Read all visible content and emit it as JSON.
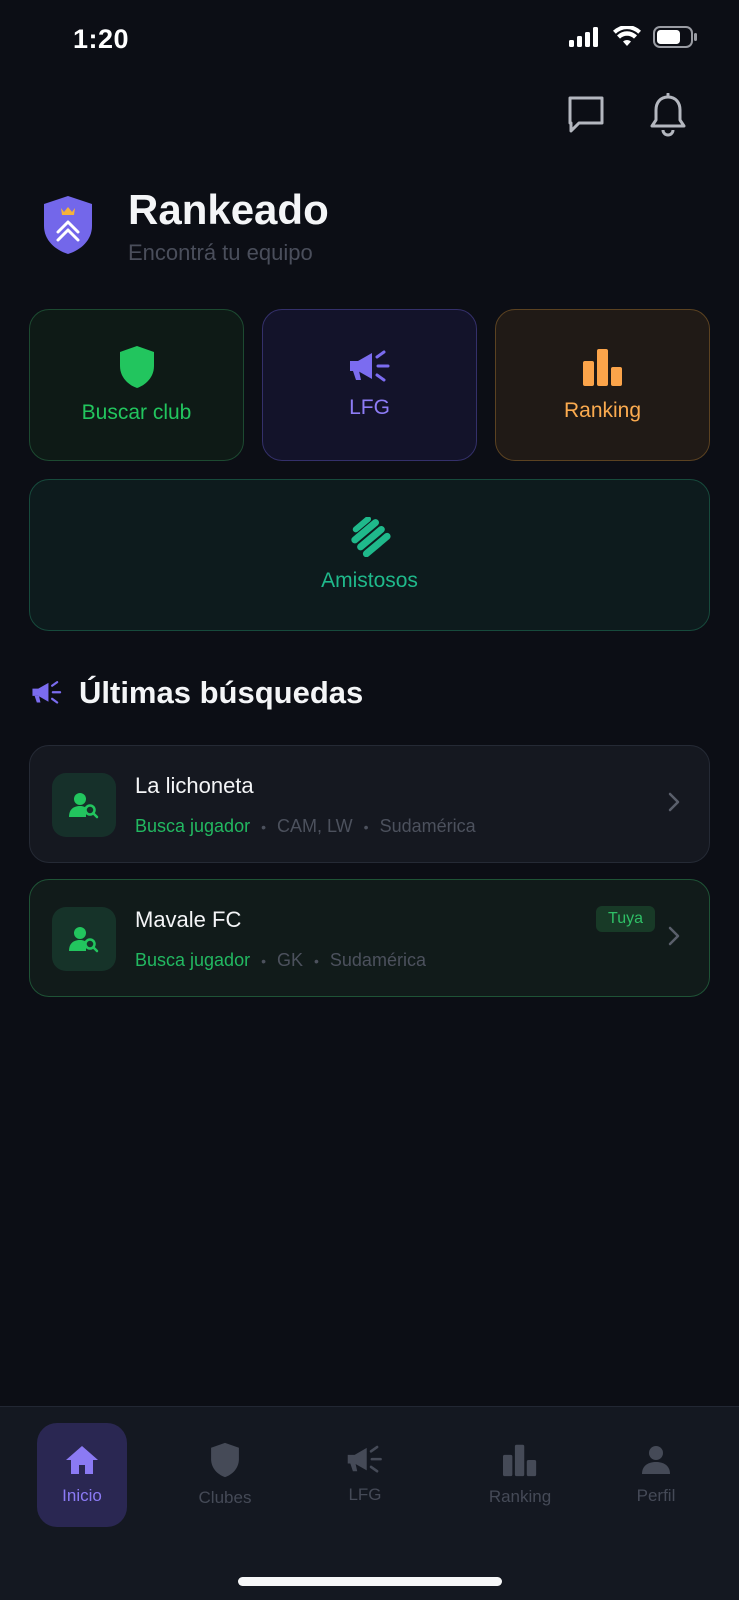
{
  "status_bar": {
    "time": "1:20"
  },
  "brand": {
    "title": "Rankeado",
    "subtitle": "Encontrá tu equipo"
  },
  "tiles": [
    {
      "label": "Buscar club",
      "icon": "shield-icon",
      "color": "#22c55e"
    },
    {
      "label": "LFG",
      "icon": "megaphone-icon",
      "color": "#8d7cf6"
    },
    {
      "label": "Ranking",
      "icon": "bar-chart-icon",
      "color": "#fbab4f"
    },
    {
      "label": "Amistosos",
      "icon": "handshake-icon",
      "color": "#1fb98b"
    }
  ],
  "section": {
    "title": "Últimas búsquedas",
    "icon": "megaphone-icon"
  },
  "searches": [
    {
      "name": "La lichoneta",
      "status": "Busca jugador",
      "positions": "CAM, LW",
      "region": "Sudamérica",
      "badge": ""
    },
    {
      "name": "Mavale FC",
      "status": "Busca jugador",
      "positions": "GK",
      "region": "Sudamérica",
      "badge": "Tuya"
    }
  ],
  "nav": [
    {
      "label": "Inicio",
      "icon": "home-icon",
      "active": true
    },
    {
      "label": "Clubes",
      "icon": "shield-icon",
      "active": false
    },
    {
      "label": "LFG",
      "icon": "megaphone-icon",
      "active": false
    },
    {
      "label": "Ranking",
      "icon": "bar-chart-icon",
      "active": false
    },
    {
      "label": "Perfil",
      "icon": "person-icon",
      "active": false
    }
  ],
  "colors": {
    "background": "#0c0e15",
    "accent": "#8b7af4",
    "green": "#22c55e",
    "orange": "#fbab4f",
    "teal": "#1fb98b"
  }
}
